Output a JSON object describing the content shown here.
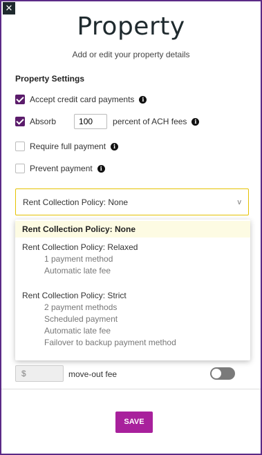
{
  "dialog": {
    "close_glyph": "✕",
    "title": "Property",
    "subtitle": "Add or edit your property details",
    "accent_color": "#a8219c",
    "border_color": "#5b2a86"
  },
  "settings": {
    "section_title": "Property Settings",
    "accept_credit": {
      "label": "Accept credit card payments",
      "checked": true
    },
    "absorb": {
      "label": "Absorb",
      "checked": true,
      "value": "100",
      "suffix": "percent of ACH fees"
    },
    "require_full": {
      "label": "Require full payment",
      "checked": false
    },
    "prevent_payment": {
      "label": "Prevent payment",
      "checked": false
    },
    "info_glyph": "i"
  },
  "policy_select": {
    "value": "Rent Collection Policy: None",
    "chevron": "v",
    "options": [
      {
        "label": "Rent Collection Policy: None",
        "details": []
      },
      {
        "label": "Rent Collection Policy: Relaxed",
        "details": [
          "1 payment method",
          "Automatic late fee"
        ]
      },
      {
        "label": "Rent Collection Policy: Strict",
        "details": [
          "2 payment methods",
          "Scheduled payment",
          "Automatic late fee",
          "Failover to backup payment method"
        ]
      }
    ]
  },
  "move_out": {
    "placeholder": "$",
    "label": "move-out fee",
    "enabled": false
  },
  "save_label": "SAVE"
}
